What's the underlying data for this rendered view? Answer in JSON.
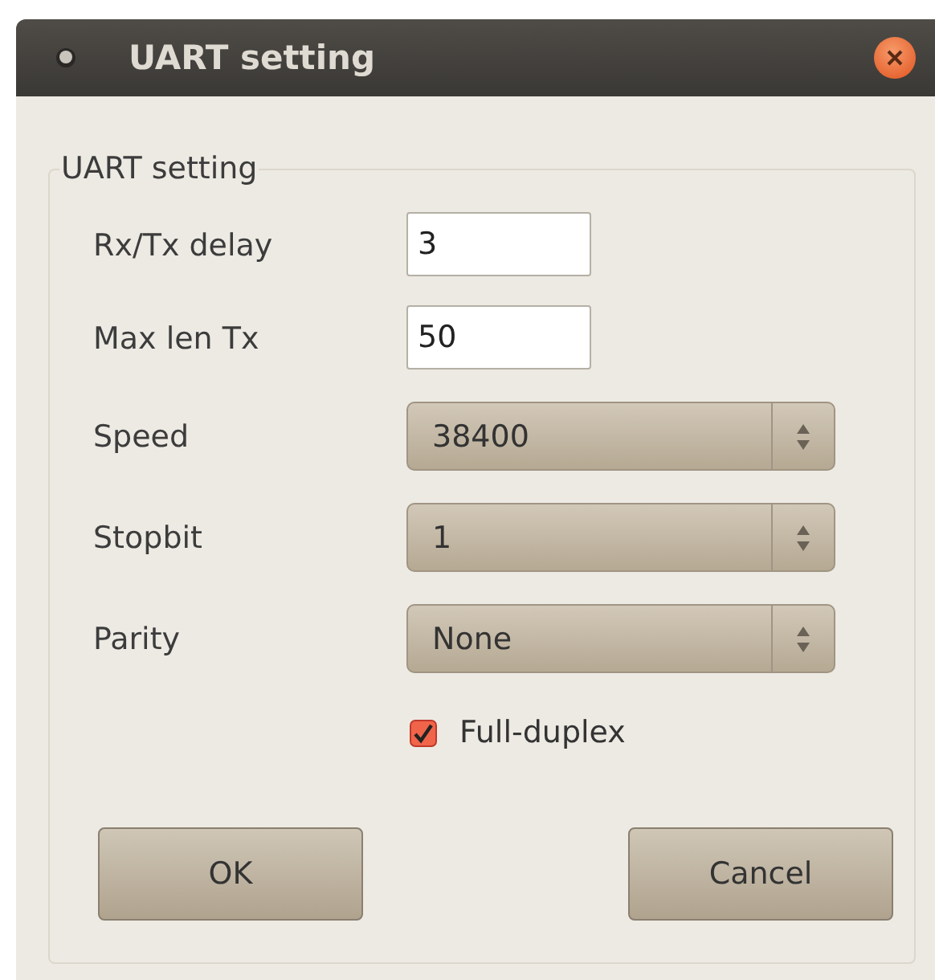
{
  "window": {
    "title": "UART setting"
  },
  "group": {
    "title": "UART setting"
  },
  "fields": [
    {
      "kind": "text",
      "label": "Rx/Tx delay",
      "value": "3"
    },
    {
      "kind": "text",
      "label": "Max len Tx",
      "value": "50"
    },
    {
      "kind": "combo",
      "label": "Speed",
      "value": "38400"
    },
    {
      "kind": "combo",
      "label": "Stopbit",
      "value": "1"
    },
    {
      "kind": "combo",
      "label": "Parity",
      "value": "None"
    }
  ],
  "checkbox": {
    "label": "Full-duplex",
    "checked": true
  },
  "buttons": [
    "OK",
    "Cancel"
  ]
}
